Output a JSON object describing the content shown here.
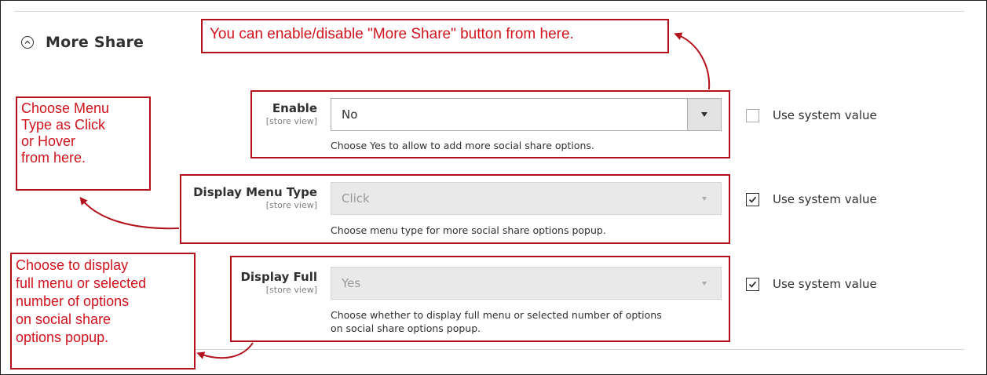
{
  "section": {
    "title": "More Share"
  },
  "fields": [
    {
      "label": "Enable",
      "scope": "[store view]",
      "value": "No",
      "note": "Choose Yes to allow to add more social share options.",
      "use_system_value": "Use system value",
      "system_checked": false,
      "disabled": false
    },
    {
      "label": "Display Menu Type",
      "scope": "[store view]",
      "value": "Click",
      "note": "Choose menu type for more social share options popup.",
      "use_system_value": "Use system value",
      "system_checked": true,
      "disabled": true
    },
    {
      "label": "Display Full",
      "scope": "[store view]",
      "value": "Yes",
      "note_line1": "Choose whether to display full menu or selected number of options",
      "note_line2": "on social share options popup.",
      "use_system_value": "Use system value",
      "system_checked": true,
      "disabled": true
    }
  ],
  "callouts": {
    "top": "You can enable/disable \"More Share\" button from here.",
    "menu_type": [
      "Choose Menu",
      "Type as Click",
      "or Hover",
      "from here."
    ],
    "display_full": [
      "Choose to display",
      "full menu or selected",
      "number of options",
      "on social share",
      "options popup."
    ]
  },
  "colors": {
    "annotation_red": "#d0131d",
    "annotation_border": "#b3121c",
    "text": "#303030"
  }
}
